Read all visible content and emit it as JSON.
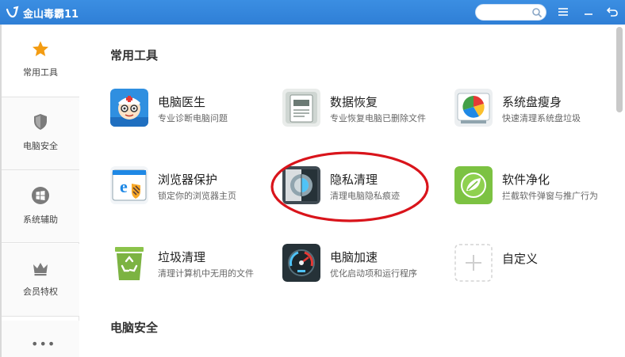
{
  "app": {
    "title": "金山毒霸11"
  },
  "search": {
    "placeholder": ""
  },
  "sidebar": {
    "items": [
      {
        "label": "常用工具",
        "icon": "star-icon"
      },
      {
        "label": "电脑安全",
        "icon": "shield-icon"
      },
      {
        "label": "系统辅助",
        "icon": "windows-icon"
      },
      {
        "label": "会员特权",
        "icon": "crown-icon"
      }
    ],
    "more": "•••"
  },
  "sections": [
    {
      "title": "常用工具"
    },
    {
      "title": "电脑安全"
    }
  ],
  "tools": [
    {
      "name": "电脑医生",
      "desc": "专业诊断电脑问题",
      "icon": "doctor-icon"
    },
    {
      "name": "数据恢复",
      "desc": "专业恢复电脑已删除文件",
      "icon": "data-recovery-icon"
    },
    {
      "name": "系统盘瘦身",
      "desc": "快速清理系统盘垃圾",
      "icon": "disk-slim-icon"
    },
    {
      "name": "浏览器保护",
      "desc": "锁定你的浏览器主页",
      "icon": "browser-protect-icon"
    },
    {
      "name": "隐私清理",
      "desc": "清理电脑隐私痕迹",
      "icon": "privacy-clean-icon"
    },
    {
      "name": "软件净化",
      "desc": "拦截软件弹窗与推广行为",
      "icon": "software-purify-icon"
    },
    {
      "name": "垃圾清理",
      "desc": "清理计算机中无用的文件",
      "icon": "trash-clean-icon"
    },
    {
      "name": "电脑加速",
      "desc": "优化启动项和运行程序",
      "icon": "speedup-icon"
    },
    {
      "name": "自定义",
      "desc": "",
      "icon": "add-icon"
    }
  ],
  "colors": {
    "titlebar": "#3b8ee2",
    "star": "#f39c12",
    "annotation": "#d9141b"
  }
}
